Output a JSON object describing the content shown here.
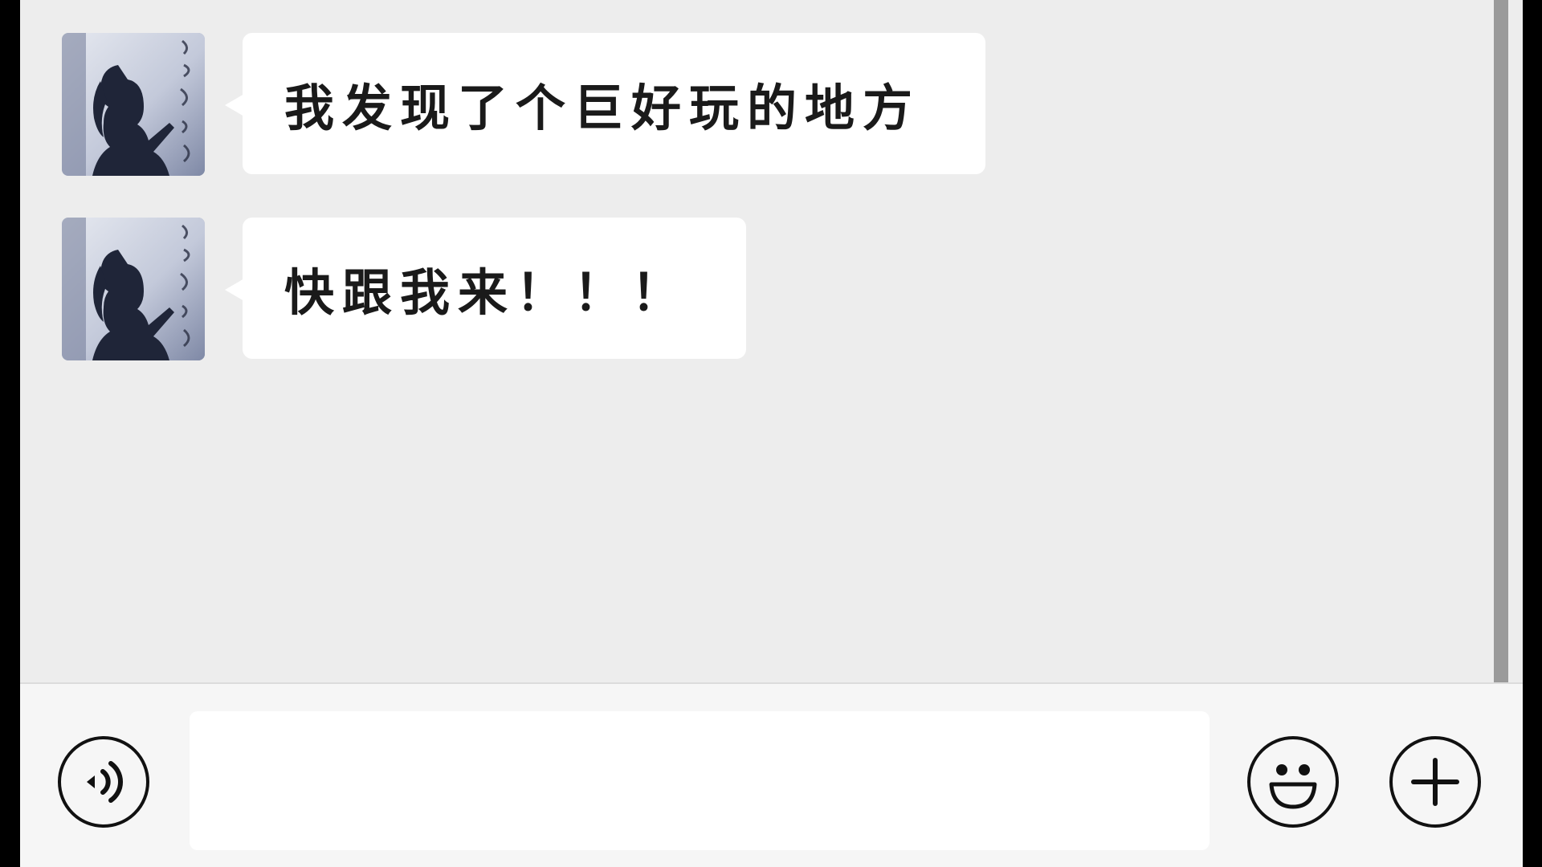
{
  "chat": {
    "messages": [
      {
        "sender": "contact",
        "text": "我发现了个巨好玩的地方"
      },
      {
        "sender": "contact",
        "text": "快跟我来！！！"
      }
    ]
  },
  "input_bar": {
    "text_value": "",
    "placeholder": "",
    "icons": {
      "voice": "voice-icon",
      "emoji": "emoji-icon",
      "more": "plus-icon"
    }
  },
  "colors": {
    "chat_background": "#ededed",
    "bubble": "#ffffff",
    "input_bar_background": "#f6f6f6",
    "text": "#1a1a1a"
  }
}
